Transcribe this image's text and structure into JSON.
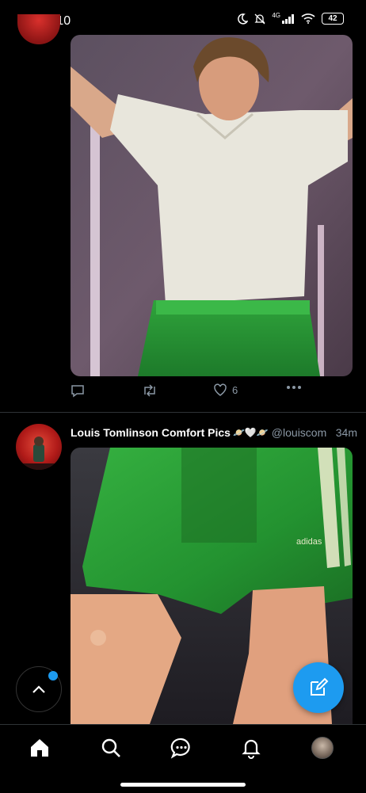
{
  "status_bar": {
    "time": "2:10",
    "network": "4G",
    "battery": "42"
  },
  "tweet1": {
    "likes": "6"
  },
  "tweet2": {
    "name": "Louis Tomlinson Comfort Pics",
    "name_emoji": "🪐🤍🪐",
    "handle": "@louiscomf…",
    "time": "34m"
  },
  "colors": {
    "accent": "#1d9bf0",
    "background": "#000000",
    "muted": "#8b98a5"
  },
  "icons": {
    "actions": [
      "reply-icon",
      "retweet-icon",
      "like-icon",
      "more-icon"
    ],
    "nav": [
      "home-icon",
      "search-icon",
      "messages-icon",
      "notifications-icon",
      "profile-avatar"
    ],
    "fab": "compose-icon",
    "scroll": "chevron-up-icon"
  }
}
